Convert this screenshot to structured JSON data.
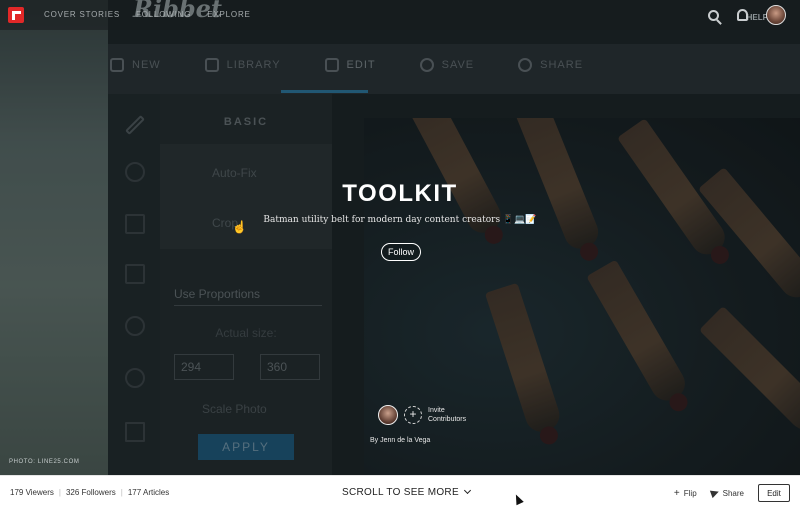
{
  "topnav": {
    "links": [
      "COVER STORIES",
      "FOLLOWING",
      "EXPLORE"
    ],
    "help_label": "HELP"
  },
  "background_app": {
    "tabs": [
      "NEW",
      "LIBRARY",
      "EDIT",
      "SAVE",
      "SHARE"
    ],
    "panel_heading": "BASIC",
    "panel_items": [
      "Auto-Fix",
      "Crop"
    ],
    "select_value": "Use Proportions",
    "size_label": "Actual size:",
    "width_value": "294",
    "height_value": "360",
    "scale_label": "Scale Photo",
    "apply_label": "APPLY"
  },
  "magazine": {
    "title": "TOOLKIT",
    "description": "Batman utility belt for modern day content creators 📱💻📝",
    "follow_label": "Follow",
    "invite_label_1": "Invite",
    "invite_label_2": "Contributors",
    "byline": "By Jenn de la Vega",
    "photo_credit": "PHOTO: LINE25.COM"
  },
  "bottom": {
    "viewers": "179 Viewers",
    "followers": "326 Followers",
    "articles": "177 Articles",
    "scroll_label": "SCROLL TO SEE MORE",
    "flip_label": "Flip",
    "share_label": "Share",
    "edit_label": "Edit"
  },
  "colors": {
    "brand_red": "#e12828",
    "accent_blue": "#1f5f83"
  }
}
